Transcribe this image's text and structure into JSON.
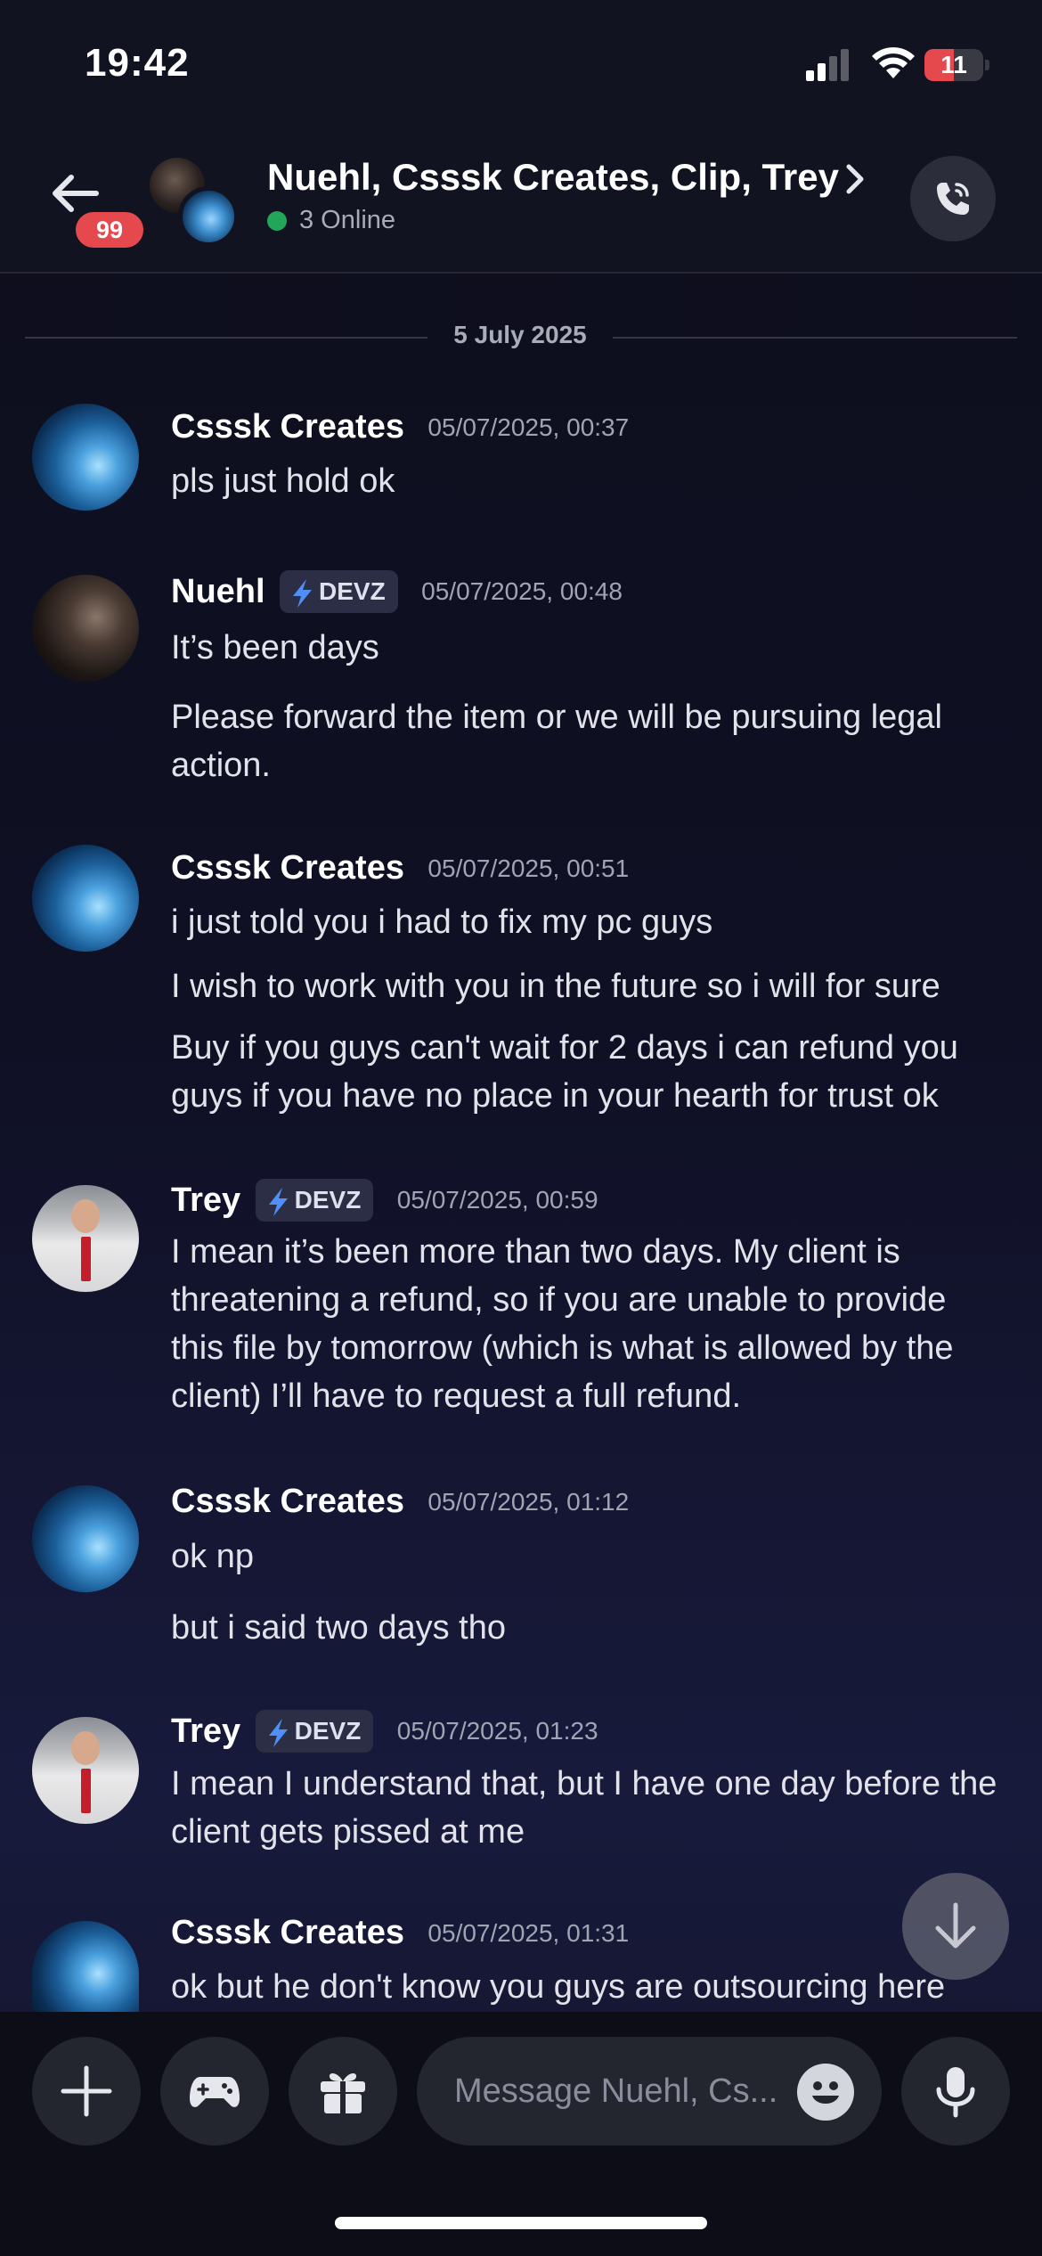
{
  "status_bar": {
    "time": "19:42",
    "battery_level": "11",
    "battery_fraction": 0.11
  },
  "header": {
    "badge_count": "99",
    "title": "Nuehl, Csssk Creates, Clip, Trey",
    "online": "3 Online"
  },
  "date_divider": "5 July 2025",
  "messages": [
    {
      "author": "Csssk Creates",
      "timestamp": "05/07/2025, 00:37",
      "tag": "",
      "lines": [
        "pls just hold ok"
      ]
    },
    {
      "author": "Nuehl",
      "tag": "DEVZ",
      "timestamp": "05/07/2025, 00:48",
      "lines": [
        "It’s been days",
        "Please forward the item or we will be pursuing legal action."
      ]
    },
    {
      "author": "Csssk Creates",
      "tag": "",
      "timestamp": "05/07/2025, 00:51",
      "lines": [
        "i just told you i had to fix my pc guys",
        "I wish to work with you in the future so i will for sure",
        "Buy if you guys can't wait for 2 days i can refund you guys if you have no place in your hearth for trust ok"
      ]
    },
    {
      "author": "Trey",
      "tag": "DEVZ",
      "timestamp": "05/07/2025, 00:59",
      "lines": [
        "I mean it’s been more than two days. My client is threatening a refund, so if you are unable to provide this file by tomorrow (which is what is allowed by the client) I’ll have to request a full refund."
      ]
    },
    {
      "author": "Csssk Creates",
      "tag": "",
      "timestamp": "05/07/2025, 01:12",
      "lines": [
        "ok np",
        "but i said two days tho"
      ]
    },
    {
      "author": "Trey",
      "tag": "DEVZ",
      "timestamp": "05/07/2025, 01:23",
      "lines": [
        "I mean I understand that, but I have one day before the client gets pissed at me"
      ]
    },
    {
      "author": "Csssk Creates",
      "tag": "",
      "timestamp": "05/07/2025, 01:31",
      "lines": [
        "ok but he don't know you guys are outsourcing here"
      ]
    }
  ],
  "composer": {
    "placeholder": "Message Nuehl, Cs..."
  },
  "colors": {
    "accent_red": "#e5484d",
    "online_green": "#23a55a",
    "tag_bg": "#2b2e44",
    "tag_bolt": "#4f8ff7"
  },
  "icons": [
    "back-arrow-icon",
    "chevron-right-icon",
    "phone-icon",
    "lightning-bolt-icon",
    "arrow-down-icon",
    "plus-icon",
    "gamepad-icon",
    "gift-icon",
    "emoji-icon",
    "microphone-icon"
  ]
}
